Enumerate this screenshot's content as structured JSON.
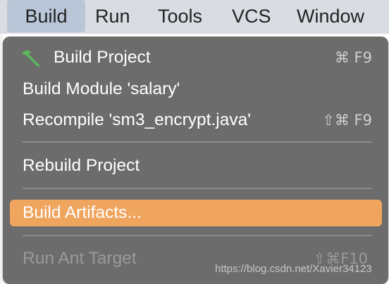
{
  "menubar": {
    "items": [
      "Build",
      "Run",
      "Tools",
      "VCS",
      "Window"
    ],
    "active": "Build"
  },
  "menu": {
    "items": [
      {
        "label": "Build Project",
        "shortcut": "⌘ F9",
        "icon": "hammer-icon"
      },
      {
        "label": "Build Module 'salary'",
        "shortcut": ""
      },
      {
        "label": "Recompile 'sm3_encrypt.java'",
        "shortcut": "⇧⌘ F9"
      },
      {
        "label": "Rebuild Project",
        "shortcut": ""
      },
      {
        "label": "Build Artifacts...",
        "shortcut": "",
        "highlighted": true
      },
      {
        "label": "Run Ant Target",
        "shortcut": "⇧⌘F10",
        "disabled": true
      }
    ],
    "highlight_color": "#f0a55e",
    "background_color": "#6c6c6c"
  },
  "watermark": "https://blog.csdn.net/Xavier34123"
}
